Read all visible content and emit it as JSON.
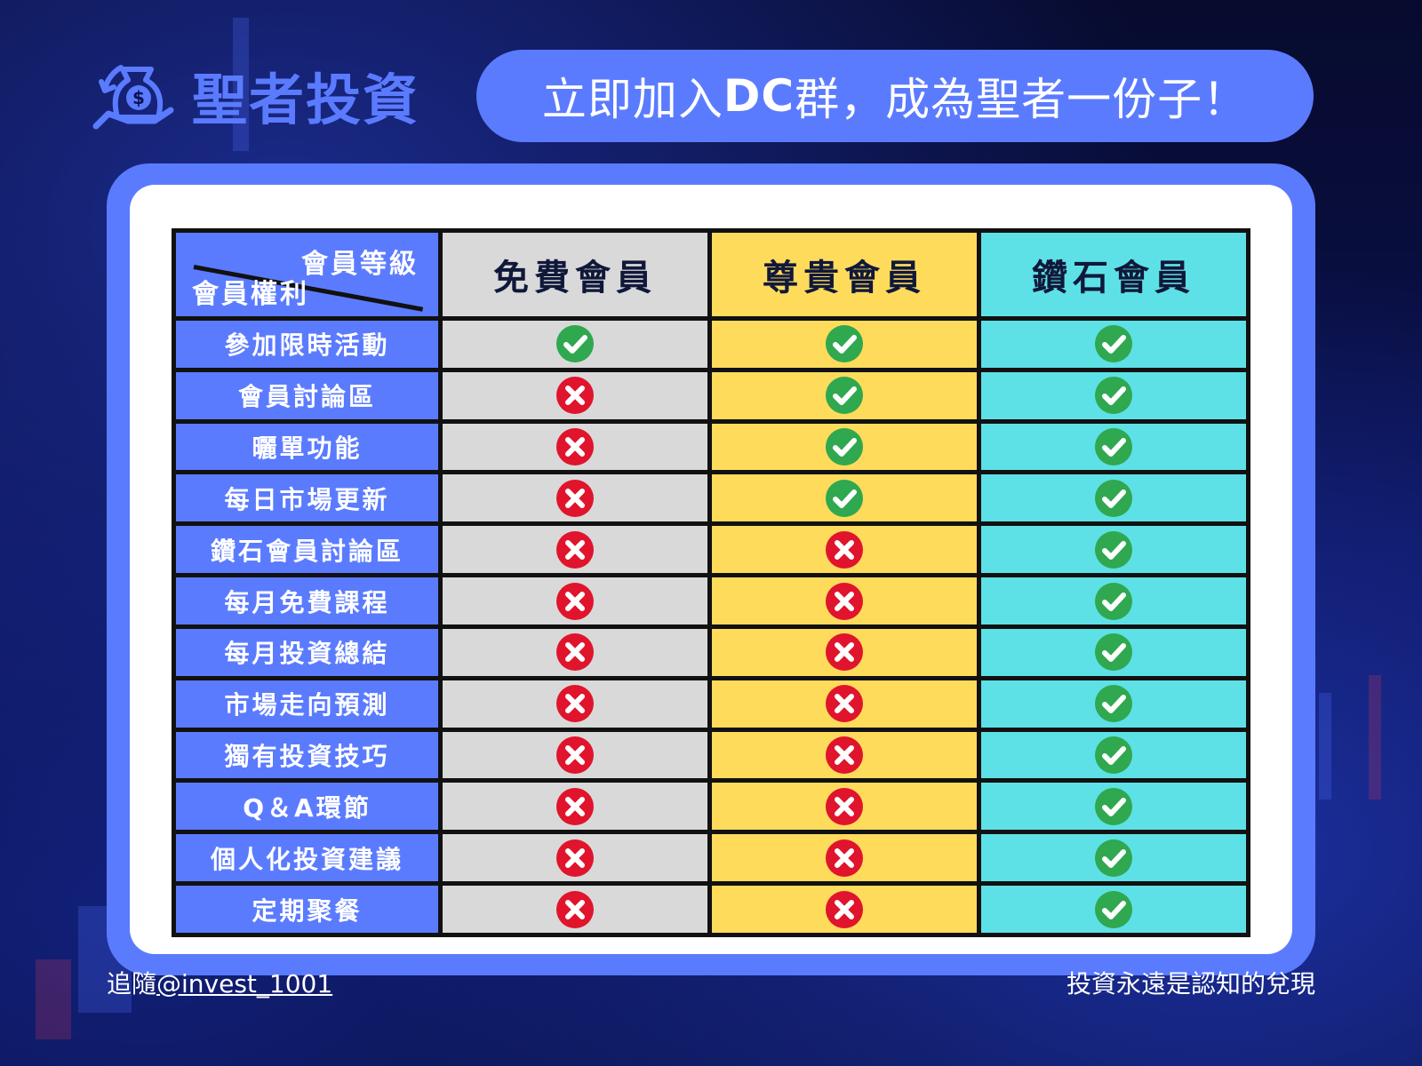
{
  "brand": {
    "name": "聖者投資",
    "icon": "money-bag-hand-icon"
  },
  "banner": {
    "prefix": "立即加入",
    "bold": "DC",
    "suffix": "群，成為聖者一份子！"
  },
  "table": {
    "corner_top": "會員等級",
    "corner_bottom": "會員權利",
    "tiers": [
      {
        "name": "免費會員",
        "color": "#d9d9d9"
      },
      {
        "name": "尊貴會員",
        "color": "#ffdb5c"
      },
      {
        "name": "鑽石會員",
        "color": "#5de1e6"
      }
    ],
    "rows": [
      {
        "feature": "參加限時活動",
        "values": [
          true,
          true,
          true
        ]
      },
      {
        "feature": "會員討論區",
        "values": [
          false,
          true,
          true
        ]
      },
      {
        "feature": "曬單功能",
        "values": [
          false,
          true,
          true
        ]
      },
      {
        "feature": "每日市場更新",
        "values": [
          false,
          true,
          true
        ]
      },
      {
        "feature": "鑽石會員討論區",
        "values": [
          false,
          false,
          true
        ]
      },
      {
        "feature": "每月免費課程",
        "values": [
          false,
          false,
          true
        ]
      },
      {
        "feature": "每月投資總結",
        "values": [
          false,
          false,
          true
        ]
      },
      {
        "feature": "市場走向預測",
        "values": [
          false,
          false,
          true
        ]
      },
      {
        "feature": "獨有投資技巧",
        "values": [
          false,
          false,
          true
        ]
      },
      {
        "feature": "Q＆A環節",
        "values": [
          false,
          false,
          true
        ]
      },
      {
        "feature": "個人化投資建議",
        "values": [
          false,
          false,
          true
        ]
      },
      {
        "feature": "定期聚餐",
        "values": [
          false,
          false,
          true
        ]
      }
    ]
  },
  "footer": {
    "follow_prefix": "追隨",
    "handle": "@invest_1001",
    "slogan": "投資永遠是認知的兌現"
  },
  "colors": {
    "accent": "#5b7bff",
    "check": "#2fa84f",
    "cross": "#e0142c"
  }
}
